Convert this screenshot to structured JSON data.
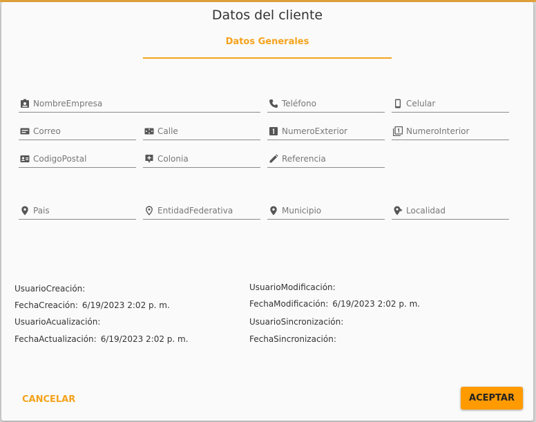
{
  "dialog": {
    "title": "Datos del cliente"
  },
  "tabs": [
    {
      "label": "Datos Generales"
    }
  ],
  "fields": {
    "nombre_empresa": "NombreEmpresa",
    "telefono": "Teléfono",
    "celular": "Celular",
    "correo": "Correo",
    "calle": "Calle",
    "numero_exterior": "NumeroExterior",
    "numero_interior": "NumeroInterior",
    "codigo_postal": "CodigoPostal",
    "colonia": "Colonia",
    "referencia": "Referencia",
    "pais": "Pais",
    "entidad_federativa": "EntidadFederativa",
    "municipio": "Municipio",
    "localidad": "Localidad"
  },
  "audit": {
    "usuario_creacion_label": "UsuarioCreación:",
    "usuario_creacion_value": "",
    "fecha_creacion_label": "FechaCreación:",
    "fecha_creacion_value": "6/19/2023 2:02 p. m.",
    "usuario_actualizacion_label": "UsuarioAcualización:",
    "usuario_actualizacion_value": "",
    "fecha_actualizacion_label": "FechaActualización:",
    "fecha_actualizacion_value": "6/19/2023 2:02 p. m.",
    "usuario_modificacion_label": "UsuarioModificación:",
    "usuario_modificacion_value": "",
    "fecha_modificacion_label": "FechaModificación:",
    "fecha_modificacion_value": "6/19/2023 2:02 p. m.",
    "usuario_sincronizacion_label": "UsuarioSincronización:",
    "usuario_sincronizacion_value": "",
    "fecha_sincronizacion_label": "FechaSincronización:",
    "fecha_sincronizacion_value": ""
  },
  "actions": {
    "cancel": "CANCELAR",
    "accept": "ACEPTAR"
  },
  "icons": {
    "nombre_empresa": "badge-icon",
    "telefono": "phone-icon",
    "celular": "smartphone-icon",
    "correo": "mail-card-icon",
    "calle": "road-icon",
    "numero_exterior": "number-one-icon",
    "numero_interior": "number-one-stack-icon",
    "codigo_postal": "contact-card-icon",
    "colonia": "add-location-icon",
    "referencia": "pencil-icon",
    "pais": "place-icon",
    "entidad_federativa": "place-outline-icon",
    "municipio": "place-icon",
    "localidad": "directions-location-icon"
  },
  "colors": {
    "accent": "#f5a21b",
    "accept_bg": "#ff9a00",
    "icon": "#555555"
  }
}
